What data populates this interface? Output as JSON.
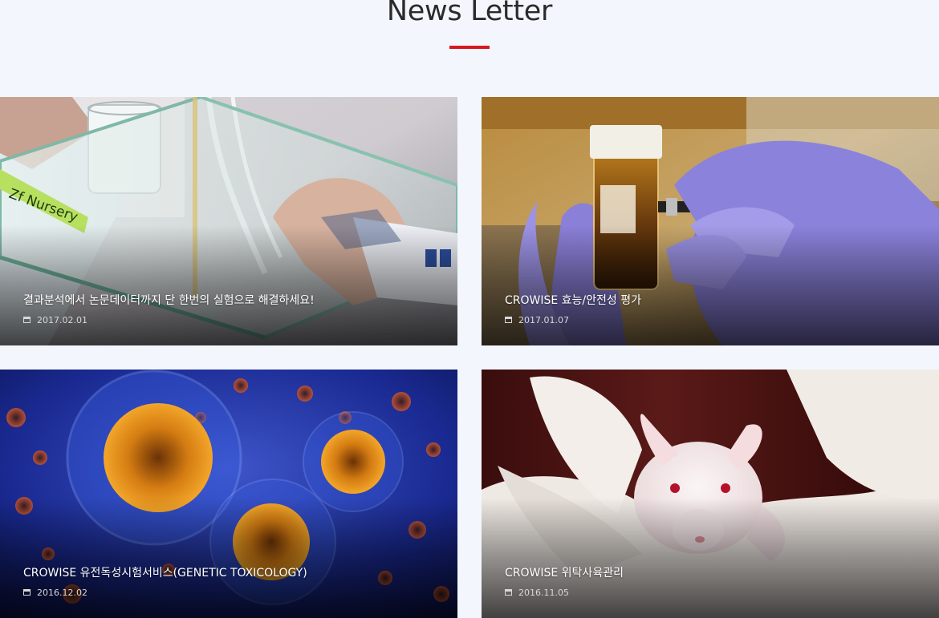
{
  "section": {
    "title": "News Letter",
    "accent_color": "#d7191f",
    "background_color": "#f3f6fd"
  },
  "posts": [
    {
      "title": "결과분석에서 논문데이터까지 단 한번의 실험으로 해결하세요!",
      "date": "2017.02.01",
      "date_icon": "calendar-icon",
      "image": "lab-researcher-glass-tank-photo"
    },
    {
      "title": "CROWISE 효능/안전성 평가",
      "date": "2017.01.07",
      "date_icon": "calendar-icon",
      "image": "gloved-hands-vial-photo"
    },
    {
      "title": "CROWISE 유전독성시험서비스(GENETIC TOXICOLOGY)",
      "date": "2016.12.02",
      "date_icon": "calendar-icon",
      "image": "cells-microscopy-illustration"
    },
    {
      "title": "CROWISE 위탁사육관리",
      "date": "2016.11.05",
      "date_icon": "calendar-icon",
      "image": "white-mouse-gloved-hand-photo"
    }
  ]
}
